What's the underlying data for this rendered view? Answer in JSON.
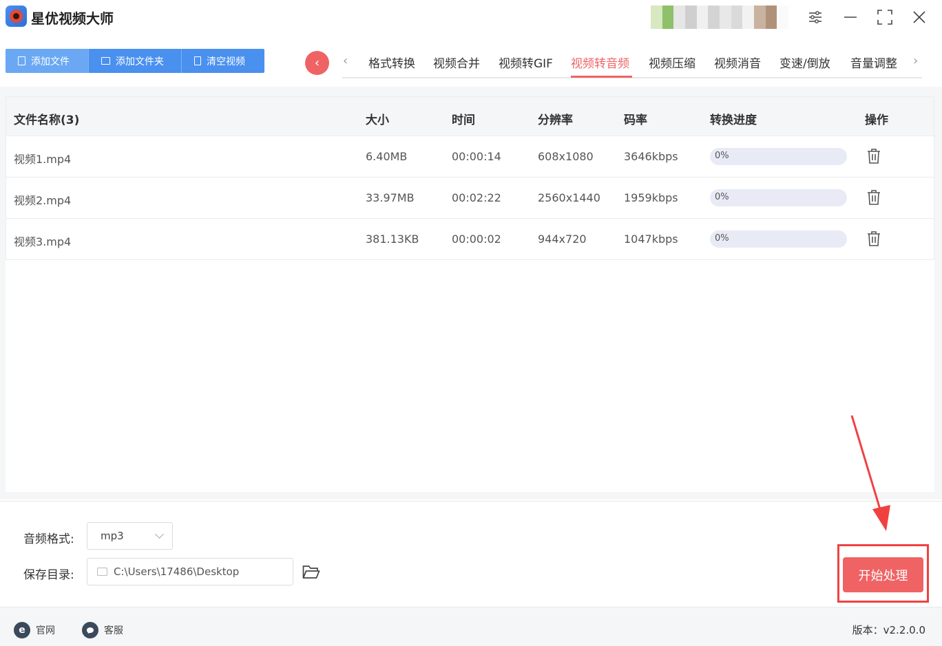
{
  "app": {
    "title": "星优视频大师"
  },
  "window_controls": [
    "settings-sliders-icon",
    "minimize-icon",
    "maximize-icon",
    "close-icon"
  ],
  "toolbar": {
    "add_file": "添加文件",
    "add_folder": "添加文件夹",
    "clear_videos": "清空视频"
  },
  "tabs": {
    "items": [
      {
        "label": "格式转换"
      },
      {
        "label": "视频合并"
      },
      {
        "label": "视频转GIF"
      },
      {
        "label": "视频转音频"
      },
      {
        "label": "视频压缩"
      },
      {
        "label": "视频消音"
      },
      {
        "label": "变速/倒放"
      },
      {
        "label": "音量调整"
      }
    ],
    "active": "视频转音频",
    "prev_arrow": "‹",
    "next_arrow": "›",
    "back_button": "‹"
  },
  "table": {
    "headers": {
      "name": "文件名称(3)",
      "size": "大小",
      "duration": "时间",
      "resolution": "分辨率",
      "bitrate": "码率",
      "progress": "转换进度",
      "action": "操作"
    },
    "rows": [
      {
        "name": "视频1.mp4",
        "size": "6.40MB",
        "duration": "00:00:14",
        "resolution": "608x1080",
        "bitrate": "3646kbps",
        "progress": "0%",
        "progress_value": 0
      },
      {
        "name": "视频2.mp4",
        "size": "33.97MB",
        "duration": "00:02:22",
        "resolution": "2560x1440",
        "bitrate": "1959kbps",
        "progress": "0%",
        "progress_value": 0
      },
      {
        "name": "视频3.mp4",
        "size": "381.13KB",
        "duration": "00:00:02",
        "resolution": "944x720",
        "bitrate": "1047kbps",
        "progress": "0%",
        "progress_value": 0
      }
    ]
  },
  "settings": {
    "audio_format_label": "音频格式:",
    "audio_format_value": "mp3",
    "save_dir_label": "保存目录:",
    "save_dir_value": "C:\\Users\\17486\\Desktop",
    "start_button": "开始处理"
  },
  "footer": {
    "website": "官网",
    "website_icon": "e",
    "support": "客服",
    "version": "版本：v2.2.0.0"
  },
  "colors": {
    "accent_red": "#f06364",
    "button_blue": "#4a90ee",
    "annotation_red": "#f04141"
  }
}
